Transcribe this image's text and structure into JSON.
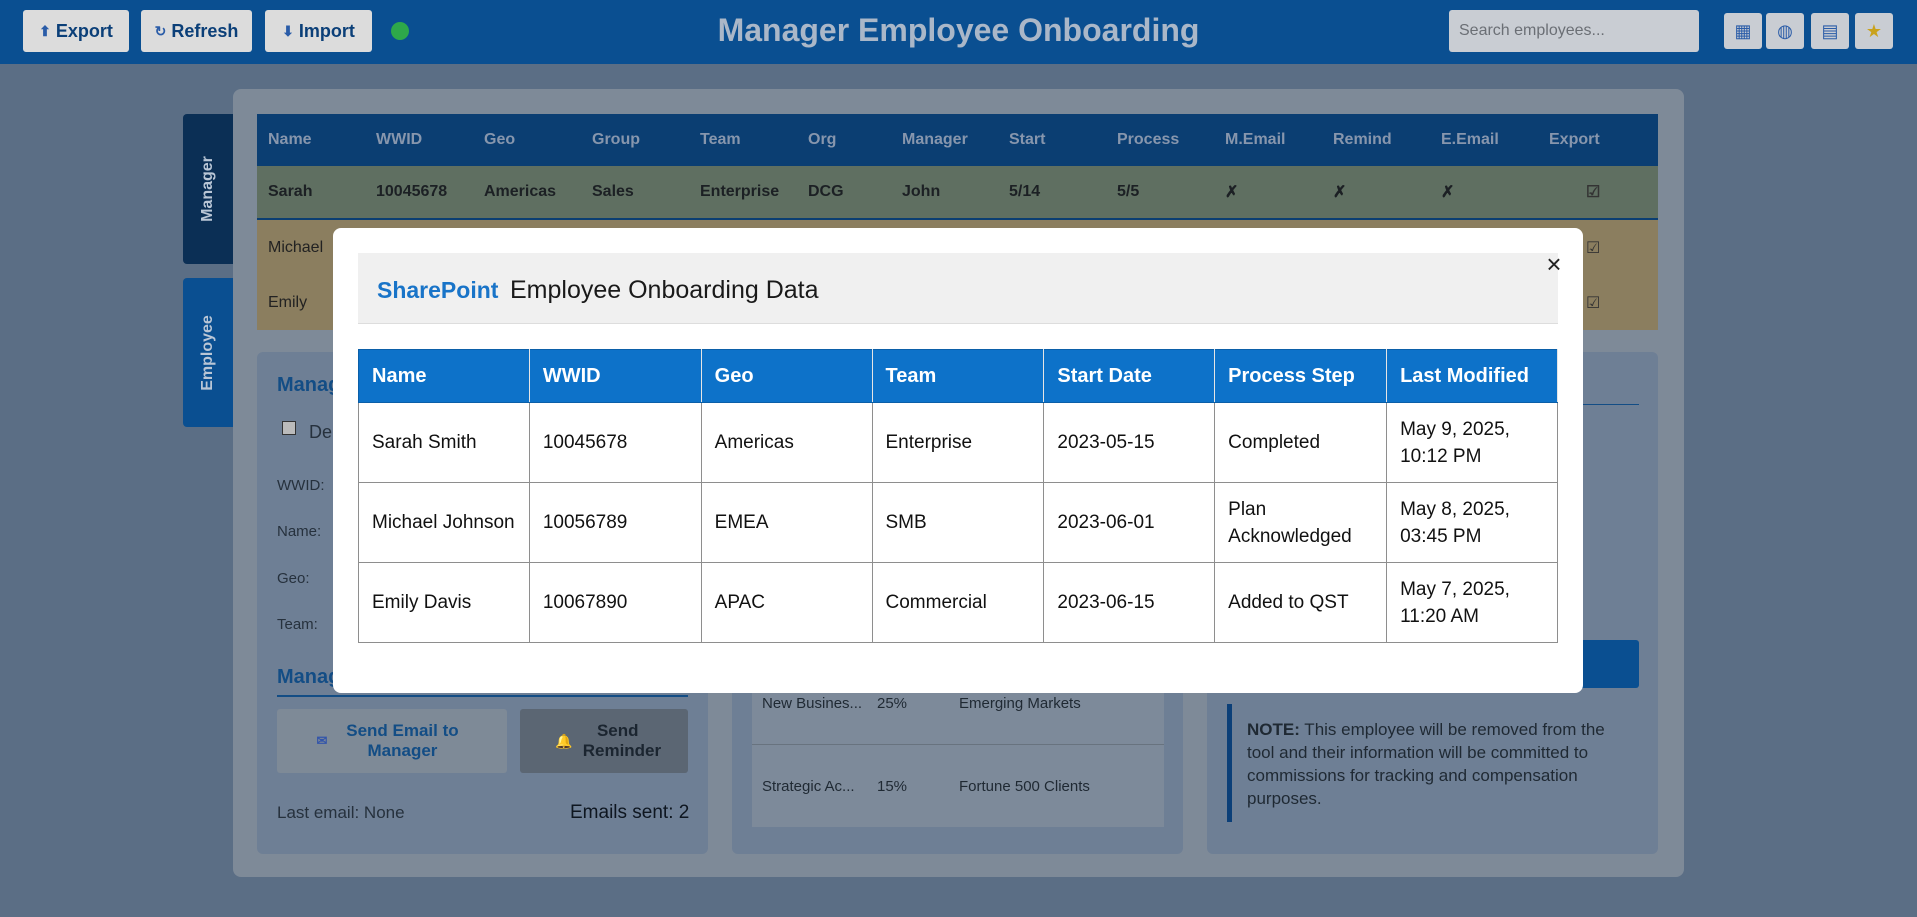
{
  "toolbar": {
    "export_label": "Export",
    "refresh_label": "Refresh",
    "import_label": "Import",
    "app_title": "Manager Employee Onboarding",
    "search_placeholder": "Search employees...",
    "status_color": "#2ea84a",
    "icon_buttons": [
      "grid-icon",
      "palette-icon",
      "calendar-icon",
      "star-icon"
    ]
  },
  "side_tabs": {
    "manager": "Manager",
    "employee": "Employee"
  },
  "grid": {
    "headers": [
      "Name",
      "WWID",
      "Geo",
      "Group",
      "Team",
      "Org",
      "Manager",
      "Start",
      "Process",
      "M.Email",
      "Remind",
      "E.Email",
      "Export"
    ],
    "rows": [
      {
        "name": "Sarah",
        "wwid": "10045678",
        "geo": "Americas",
        "group": "Sales",
        "team": "Enterprise",
        "org": "DCG",
        "manager": "John",
        "start": "5/14",
        "process": "5/5",
        "m_email": "✗",
        "remind": "✗",
        "e_email": "✗",
        "export": "☑"
      },
      {
        "name": "Michael",
        "export": "☑"
      },
      {
        "name": "Emily",
        "export": "☑"
      }
    ]
  },
  "left_panel": {
    "title_partial": "Manag",
    "checkbox_label_partial": "De",
    "fields": [
      "WWID:",
      "Name:",
      "Geo:",
      "Team:"
    ],
    "actions_title_partial": "Manag",
    "send_email_label": "Send Email to Manager",
    "send_reminder_label": "Send Reminder",
    "last_email": "Last email: None",
    "emails_sent": "Emails sent: 2"
  },
  "mid_panel": {
    "rows": [
      {
        "name": "New Busines...",
        "pct": "25%",
        "segment": "Emerging Markets"
      },
      {
        "name": "Strategic Ac...",
        "pct": "15%",
        "segment": "Fortune 500 Clients"
      }
    ]
  },
  "right_panel": {
    "note_bold": "NOTE:",
    "note_text": " This employee will be removed from the tool and their information will be committed to commissions for tracking and compensation purposes."
  },
  "modal": {
    "logo": "SharePoint",
    "title": "Employee Onboarding Data",
    "close_glyph": "×",
    "columns": [
      "Name",
      "WWID",
      "Geo",
      "Team",
      "Start Date",
      "Process Step",
      "Last Modified"
    ],
    "rows": [
      [
        "Sarah Smith",
        "10045678",
        "Americas",
        "Enterprise",
        "2023-05-15",
        "Completed",
        "May 9, 2025, 10:12 PM"
      ],
      [
        "Michael Johnson",
        "10056789",
        "EMEA",
        "SMB",
        "2023-06-01",
        "Plan Acknowledged",
        "May 8, 2025, 03:45 PM"
      ],
      [
        "Emily Davis",
        "10067890",
        "APAC",
        "Commercial",
        "2023-06-15",
        "Added to QST",
        "May 7, 2025, 11:20 AM"
      ]
    ]
  }
}
